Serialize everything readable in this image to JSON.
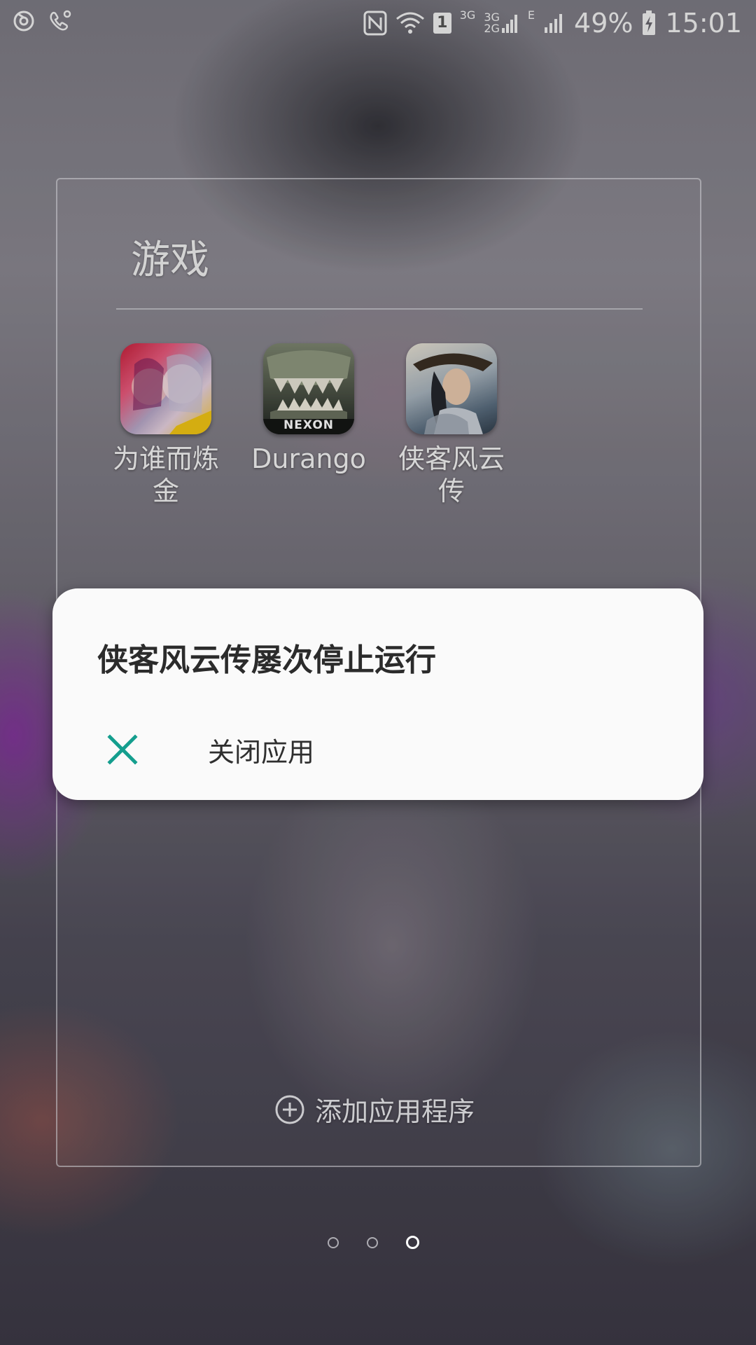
{
  "status_bar": {
    "left_icons": [
      "netease-icon",
      "phone-location-icon"
    ],
    "nfc": "N",
    "sim_badge": "1",
    "net1": "3G",
    "net2_top": "3G",
    "net2_bottom": "2G",
    "net3": "E",
    "battery_percent": "49%",
    "time": "15:01"
  },
  "folder": {
    "title": "游戏",
    "apps": [
      {
        "label": "为谁而炼\n金",
        "icon": "anime-girls-app-icon"
      },
      {
        "label": "Durango",
        "icon": "dinosaur-jaws-nexon-icon",
        "icon_text": "NEXON"
      },
      {
        "label": "侠客风云\n传",
        "icon": "wuxia-warrior-app-icon"
      }
    ],
    "add_apps_label": "添加应用程序"
  },
  "dialog": {
    "title": "侠客风云传屡次停止运行",
    "action_label": "关闭应用",
    "accent": "#149e8e"
  },
  "page_indicator": {
    "pages": 3,
    "active_page": 3
  }
}
